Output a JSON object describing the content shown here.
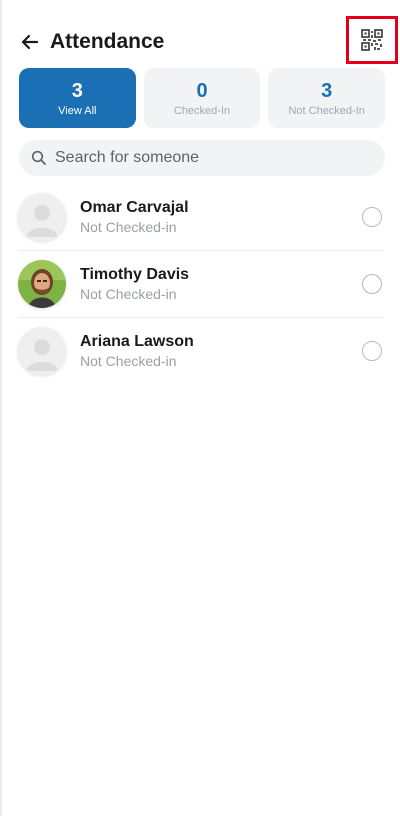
{
  "header": {
    "title": "Attendance",
    "back_icon": "arrow-left-icon",
    "qr_icon": "qr-code-icon",
    "highlight_color": "#e0001b"
  },
  "tabs": [
    {
      "count": "3",
      "label": "View All",
      "active": true
    },
    {
      "count": "0",
      "label": "Checked-In",
      "active": false
    },
    {
      "count": "3",
      "label": "Not Checked-In",
      "active": false
    }
  ],
  "search": {
    "placeholder": "Search for someone",
    "icon": "search-icon"
  },
  "attendees": [
    {
      "name": "Omar Carvajal",
      "status": "Not Checked-in",
      "avatar": "placeholder"
    },
    {
      "name": "Timothy Davis",
      "status": "Not Checked-in",
      "avatar": "photo"
    },
    {
      "name": "Ariana Lawson",
      "status": "Not Checked-in",
      "avatar": "placeholder"
    }
  ],
  "colors": {
    "accent": "#1a6fb5",
    "tab_bg": "#f1f3f5",
    "muted_text": "#9aa0a6"
  }
}
